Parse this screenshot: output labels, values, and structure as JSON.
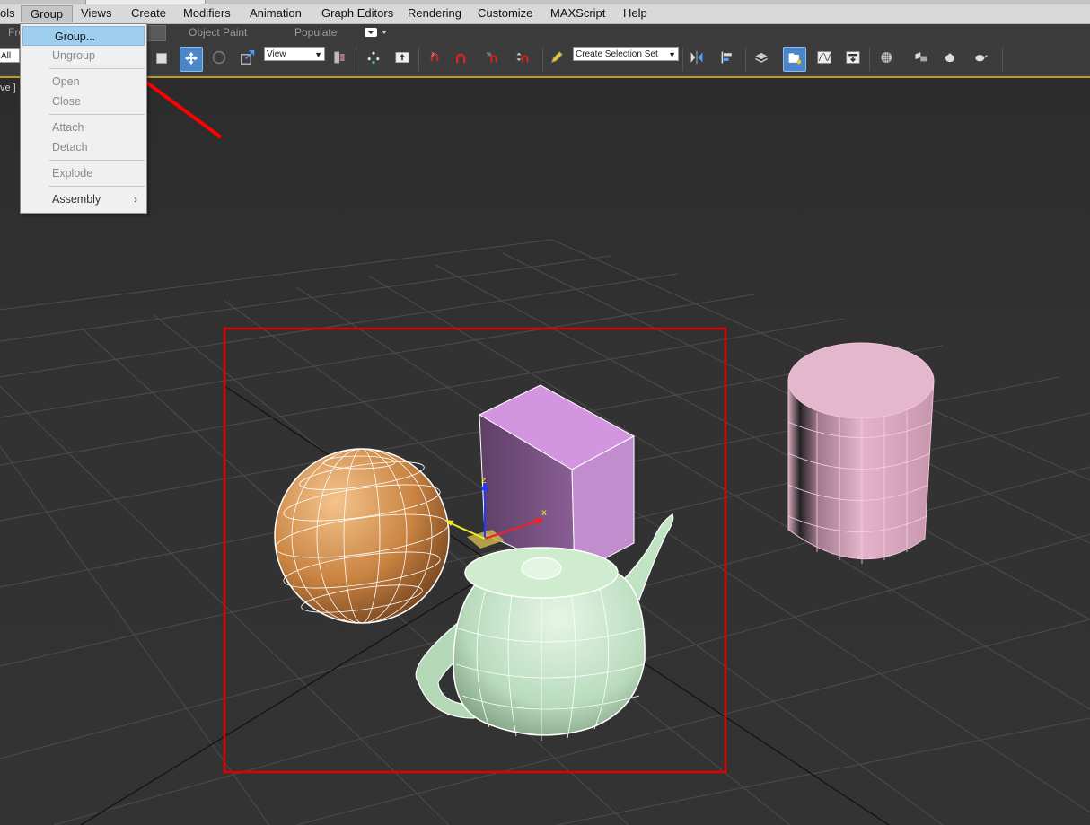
{
  "menubar": {
    "items": [
      "ols",
      "Group",
      "Views",
      "Create",
      "Modifiers",
      "Animation",
      "Graph Editors",
      "Rendering",
      "Customize",
      "MAXScript",
      "Help"
    ]
  },
  "ribbon": {
    "left_label": "Fre",
    "tabs": [
      "Object Paint",
      "Populate"
    ]
  },
  "toolbar": {
    "filter_value": "All",
    "reference_coord_value": "View",
    "selection_set_value": "Create Selection Set"
  },
  "viewport": {
    "label": "ve ]"
  },
  "group_menu": {
    "items": [
      {
        "label": "Group...",
        "state": "highlighted"
      },
      {
        "label": "Ungroup",
        "state": "disabled"
      },
      {
        "label": "Open",
        "state": "disabled"
      },
      {
        "label": "Close",
        "state": "disabled"
      },
      {
        "label": "Attach",
        "state": "disabled"
      },
      {
        "label": "Detach",
        "state": "disabled"
      },
      {
        "label": "Explode",
        "state": "disabled"
      },
      {
        "label": "Assembly",
        "state": "enabled",
        "submenu": true
      }
    ]
  },
  "annotation": {
    "arrow_color": "#ff0000",
    "box_color": "#e00000"
  },
  "scene": {
    "sphere_color": "#cc8b52",
    "box_color": "#c98fd6",
    "teapot_color": "#c4e8c8",
    "cylinder_color": "#e6b8cc",
    "wire_color": "#ffffff"
  }
}
